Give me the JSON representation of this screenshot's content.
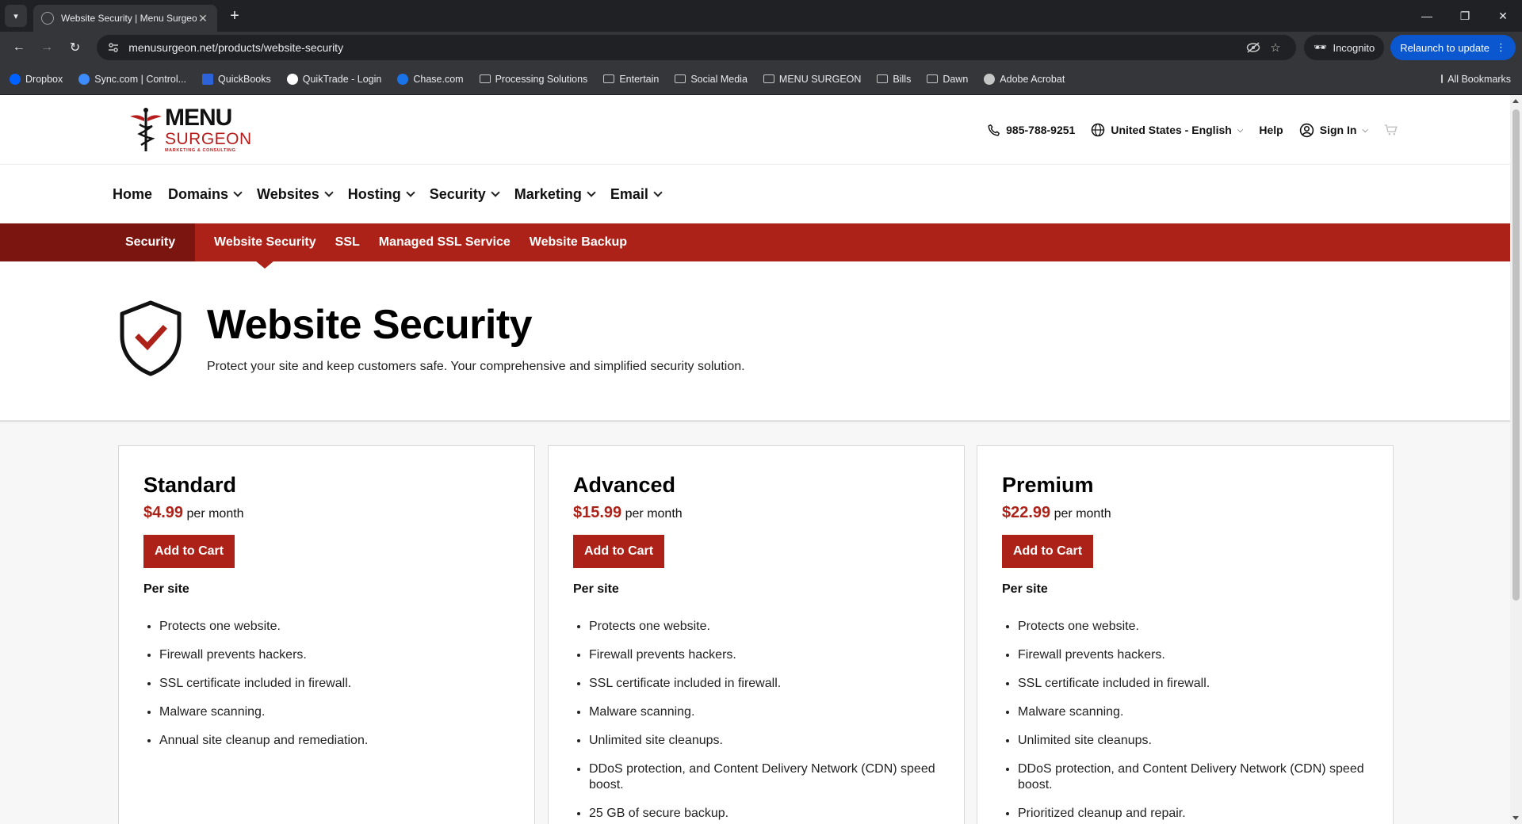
{
  "browser": {
    "tab_title": "Website Security | Menu Surgeon",
    "url": "menusurgeon.net/products/website-security",
    "incognito_label": "Incognito",
    "relaunch_label": "Relaunch to update",
    "bookmarks": [
      {
        "label": "Dropbox",
        "icon": "dropbox-icon"
      },
      {
        "label": "Sync.com | Control...",
        "icon": "sync-icon"
      },
      {
        "label": "QuickBooks",
        "icon": "quickbooks-icon"
      },
      {
        "label": "QuikTrade - Login",
        "icon": "quiktrade-icon"
      },
      {
        "label": "Chase.com",
        "icon": "chase-icon"
      },
      {
        "label": "Processing Solutions",
        "icon": "folder-icon"
      },
      {
        "label": "Entertain",
        "icon": "folder-icon"
      },
      {
        "label": "Social Media",
        "icon": "folder-icon"
      },
      {
        "label": "MENU SURGEON",
        "icon": "folder-icon"
      },
      {
        "label": "Bills",
        "icon": "folder-icon"
      },
      {
        "label": "Dawn",
        "icon": "folder-icon"
      },
      {
        "label": "Adobe Acrobat",
        "icon": "acrobat-icon"
      }
    ],
    "all_bookmarks_label": "All Bookmarks"
  },
  "header": {
    "logo": {
      "line1": "MENU",
      "line2": "SURGEON",
      "line3": "MARKETING & CONSULTING"
    },
    "phone": "985-788-9251",
    "locale": "United States - English",
    "help": "Help",
    "sign_in": "Sign In"
  },
  "main_nav": [
    {
      "label": "Home",
      "dropdown": false
    },
    {
      "label": "Domains",
      "dropdown": true
    },
    {
      "label": "Websites",
      "dropdown": true
    },
    {
      "label": "Hosting",
      "dropdown": true
    },
    {
      "label": "Security",
      "dropdown": true
    },
    {
      "label": "Marketing",
      "dropdown": true
    },
    {
      "label": "Email",
      "dropdown": true
    }
  ],
  "sub_nav": {
    "section": "Security",
    "items": [
      "Website Security",
      "SSL",
      "Managed SSL Service",
      "Website Backup"
    ]
  },
  "hero": {
    "title": "Website Security",
    "subtitle": "Protect your site and keep customers safe. Your comprehensive and simplified security solution."
  },
  "plans": [
    {
      "name": "Standard",
      "price": "$4.99",
      "period": "per month",
      "cta": "Add to Cart",
      "unit": "Per site",
      "features": [
        "Protects one website.",
        "Firewall prevents hackers.",
        "SSL certificate included in firewall.",
        "Malware scanning.",
        "Annual site cleanup and remediation."
      ]
    },
    {
      "name": "Advanced",
      "price": "$15.99",
      "period": "per month",
      "cta": "Add to Cart",
      "unit": "Per site",
      "features": [
        "Protects one website.",
        "Firewall prevents hackers.",
        "SSL certificate included in firewall.",
        "Malware scanning.",
        "Unlimited site cleanups.",
        "DDoS protection, and Content Delivery Network (CDN) speed boost.",
        "25 GB of secure backup."
      ]
    },
    {
      "name": "Premium",
      "price": "$22.99",
      "period": "per month",
      "cta": "Add to Cart",
      "unit": "Per site",
      "features": [
        "Protects one website.",
        "Firewall prevents hackers.",
        "SSL certificate included in firewall.",
        "Malware scanning.",
        "Unlimited site cleanups.",
        "DDoS protection, and Content Delivery Network (CDN) speed boost.",
        "Prioritized cleanup and repair."
      ]
    }
  ],
  "colors": {
    "brand_red": "#ad2218",
    "brand_dark_red": "#7a1510",
    "chrome_dark": "#202124",
    "relaunch_blue": "#0b57d0"
  }
}
